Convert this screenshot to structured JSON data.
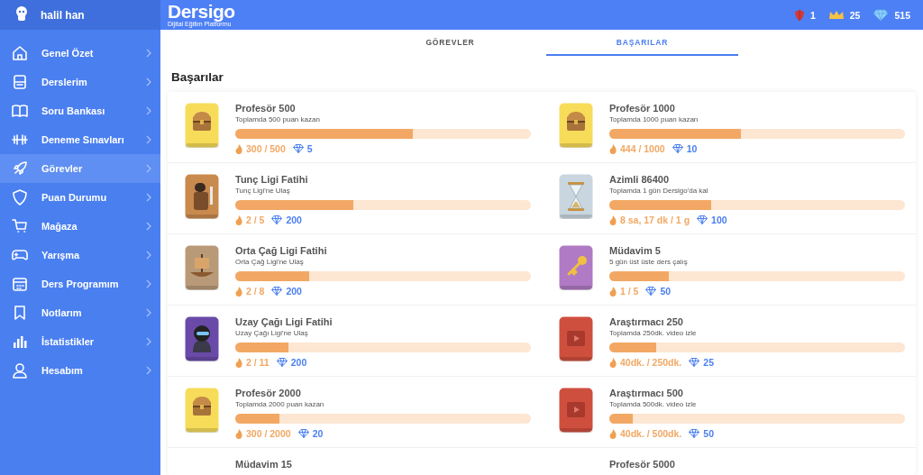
{
  "user": {
    "name": "halil han"
  },
  "sidebar": {
    "items": [
      {
        "label": "Genel Özet",
        "kind": "home",
        "selected": false
      },
      {
        "label": "Derslerim",
        "kind": "tray",
        "selected": false
      },
      {
        "label": "Soru Bankası",
        "kind": "book",
        "selected": false
      },
      {
        "label": "Deneme Sınavları",
        "kind": "dumbbell",
        "selected": false
      },
      {
        "label": "Görevler",
        "kind": "rocket",
        "selected": true
      },
      {
        "label": "Puan Durumu",
        "kind": "shield",
        "selected": false
      },
      {
        "label": "Mağaza",
        "kind": "cart",
        "selected": false
      },
      {
        "label": "Yarışma",
        "kind": "gamepad",
        "selected": false
      },
      {
        "label": "Ders Programım",
        "kind": "calendar",
        "selected": false
      },
      {
        "label": "Notlarım",
        "kind": "bookmark",
        "selected": false
      },
      {
        "label": "İstatistikler",
        "kind": "chart",
        "selected": false
      },
      {
        "label": "Hesabım",
        "kind": "user",
        "selected": false
      }
    ]
  },
  "logo": {
    "name": "Dersigo",
    "tagline": "Dijital Eğitim Platformu"
  },
  "stats": [
    {
      "kind": "shield",
      "value": "1"
    },
    {
      "kind": "crown",
      "value": "25"
    },
    {
      "kind": "diamond",
      "value": "515"
    }
  ],
  "tabs": [
    {
      "label": "GÖREVLER",
      "selected": false
    },
    {
      "label": "BAŞARILAR",
      "selected": true
    }
  ],
  "heading": "Başarılar",
  "achievements": [
    {
      "kind": "chest",
      "title": "Profesör 500",
      "description": "Toplamda 500 puan kazan",
      "level": 0.6,
      "progress": "300 / 500",
      "reward": "5"
    },
    {
      "kind": "chest",
      "title": "Profesör 1000",
      "description": "Toplamda 1000 puan kazan",
      "level": 0.444,
      "progress": "444 / 1000",
      "reward": "10"
    },
    {
      "kind": "warrior",
      "title": "Tunç Ligi Fatihi",
      "description": "Tunç Ligi'ne Ulaş",
      "level": 0.4,
      "progress": "2 / 5",
      "reward": "200"
    },
    {
      "kind": "hourglass",
      "title": "Azimli 86400",
      "description": "Toplamda 1 gün Dersigo'da kal",
      "level": 0.346,
      "progress": "8 sa, 17 dk / 1 g",
      "reward": "100"
    },
    {
      "kind": "ship",
      "title": "Orta Çağ Ligi Fatihi",
      "description": "Orta Çağ Ligi'ne Ulaş",
      "level": 0.25,
      "progress": "2 / 8",
      "reward": "200"
    },
    {
      "kind": "key",
      "title": "Müdavim 5",
      "description": "5 gün üst üste ders çalış",
      "level": 0.2,
      "progress": "1 / 5",
      "reward": "50"
    },
    {
      "kind": "astronaut",
      "title": "Uzay Çağı Ligi Fatihi",
      "description": "Uzay Çağı Ligi'ne Ulaş",
      "level": 0.18,
      "progress": "2 / 11",
      "reward": "200"
    },
    {
      "kind": "film",
      "title": "Araştırmacı 250",
      "description": "Toplamda 250dk. video izle",
      "level": 0.16,
      "progress": "40dk. / 250dk.",
      "reward": "25"
    },
    {
      "kind": "chest",
      "title": "Profesör 2000",
      "description": "Toplamda 2000 puan kazan",
      "level": 0.15,
      "progress": "300 / 2000",
      "reward": "20"
    },
    {
      "kind": "film",
      "title": "Araştırmacı 500",
      "description": "Toplamda 500dk. video izle",
      "level": 0.08,
      "progress": "40dk. / 500dk.",
      "reward": "50"
    },
    {
      "kind": "partial",
      "title": "Müdavim 15"
    },
    {
      "kind": "partial",
      "title": "Profesör 5000"
    }
  ]
}
